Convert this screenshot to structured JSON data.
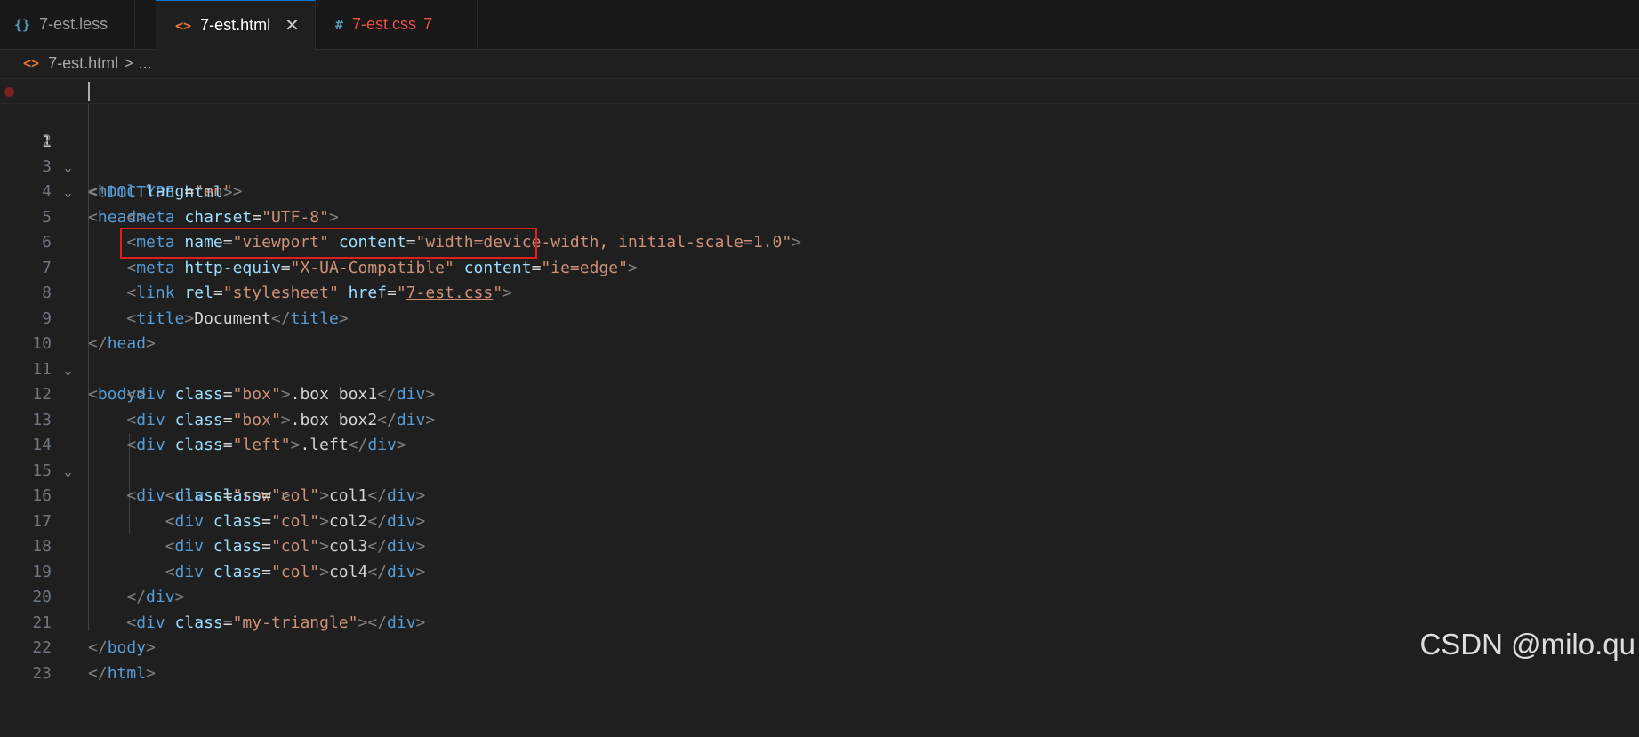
{
  "tabs": [
    {
      "icon": "{}",
      "label": "7-est.less",
      "active": false
    },
    {
      "icon": "<>",
      "label": "7-est.html",
      "active": true,
      "close": "✕"
    },
    {
      "icon": "#",
      "label": "7-est.css",
      "count": "7",
      "active": false
    }
  ],
  "breadcrumb": {
    "icon": "<>",
    "file": "7-est.html",
    "separator": ">",
    "rest": "..."
  },
  "editor": {
    "line_numbers": [
      "1",
      "2",
      "3",
      "4",
      "5",
      "6",
      "7",
      "8",
      "9",
      "10",
      "11",
      "12",
      "13",
      "14",
      "15",
      "16",
      "17",
      "18",
      "19",
      "20",
      "21",
      "22",
      "23"
    ],
    "lines": [
      "<!DOCTYPE html>",
      "<html lang=\"en\">",
      "<head>",
      "    <meta charset=\"UTF-8\">",
      "    <meta name=\"viewport\" content=\"width=device-width, initial-scale=1.0\">",
      "    <meta http-equiv=\"X-UA-Compatible\" content=\"ie=edge\">",
      "    <link rel=\"stylesheet\" href=\"7-est.css\">",
      "    <title>Document</title>",
      "</head>",
      "<body>",
      "    <div class=\"box\">.box box1</div>",
      "    <div class=\"box\">.box box2</div>",
      "    <div class=\"left\">.left</div>",
      "    <div class=\"row\">",
      "        <div class=\"col\">col1</div>",
      "        <div class=\"col\">col2</div>",
      "        <div class=\"col\">col3</div>",
      "        <div class=\"col\">col4</div>",
      "    </div>",
      "    <div class=\"my-triangle\"></div>",
      "</body>",
      "</html>",
      ""
    ],
    "fold_lines": [
      2,
      3,
      10,
      14
    ],
    "current_line": 1,
    "breakpoint_line": 1,
    "highlighted_line": 7
  },
  "watermark": "CSDN @milo.qu",
  "colors": {
    "background": "#1f1f1f",
    "tag": "#569cd6",
    "attribute": "#9cdcfe",
    "string": "#ce9178",
    "text": "#d4d4d4",
    "punctuation": "#808080",
    "highlight_box": "#e02020",
    "html_icon": "#e37933",
    "less_icon": "#519aba",
    "css_tab_text": "#f14c4c"
  },
  "icons": {
    "tab_less": "braces-icon",
    "tab_html": "html-icon",
    "tab_css": "hash-icon",
    "close": "close-icon",
    "fold": "chevron-down-icon"
  }
}
